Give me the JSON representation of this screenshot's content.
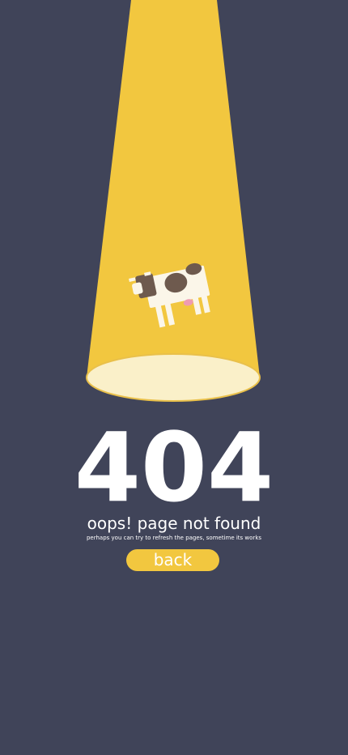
{
  "error": {
    "code": "404",
    "title": "oops! page not found",
    "subtitle": "perhaps you can try to refresh the pages, sometime its works"
  },
  "actions": {
    "back_label": "back"
  },
  "illustration": {
    "subject": "cow-icon",
    "beam_color": "#f2c73f",
    "spotlight_color": "#faf0c9"
  },
  "colors": {
    "background": "#404459",
    "accent": "#f2c73f",
    "text": "#ffffff"
  }
}
